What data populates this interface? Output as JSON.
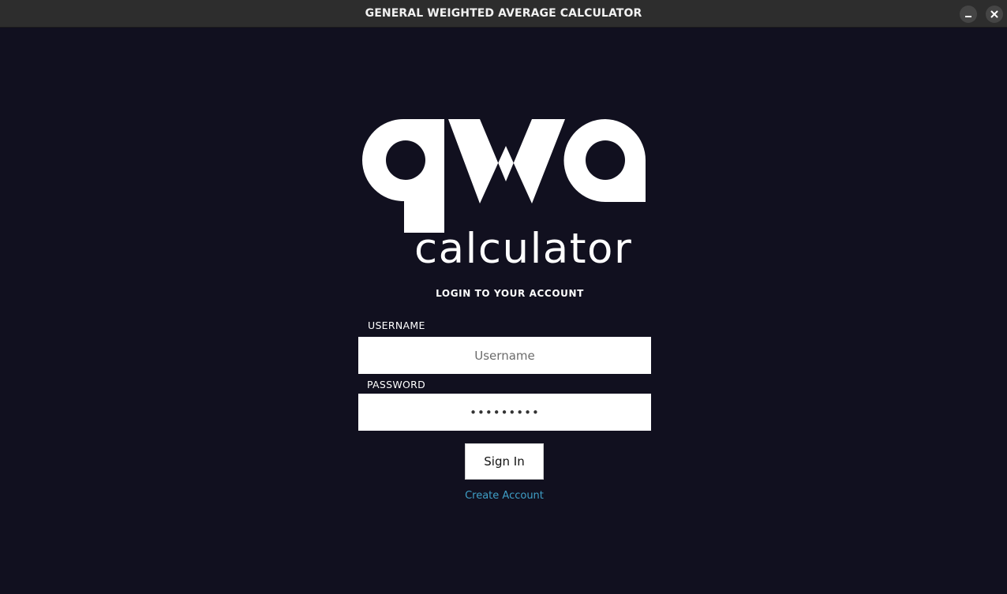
{
  "window": {
    "title": "GENERAL WEIGHTED AVERAGE CALCULATOR",
    "minimize_icon": "minimize-icon",
    "close_icon": "close-icon"
  },
  "logo": {
    "letters": "gwa",
    "subtitle": "calculator"
  },
  "login": {
    "heading": "LOGIN TO YOUR ACCOUNT",
    "username_label": "USERNAME",
    "username_placeholder": "Username",
    "username_value": "",
    "password_label": "PASSWORD",
    "password_value": "•••••••••",
    "sign_in_label": "Sign In",
    "create_account_label": "Create Account"
  },
  "colors": {
    "background": "#11101f",
    "titlebar": "#2d2d2d",
    "link": "#3f9fc7"
  }
}
